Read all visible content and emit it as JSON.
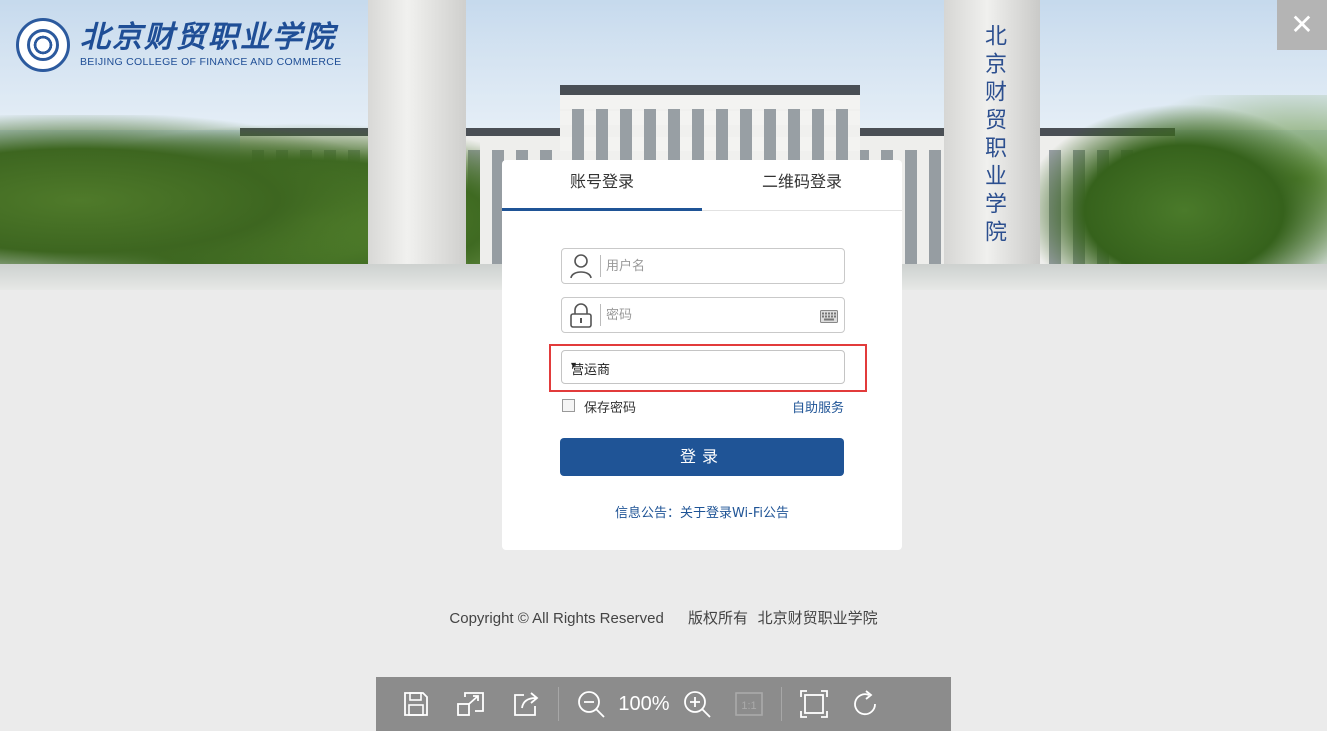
{
  "header": {
    "logo_cn": "北京财贸职业学院",
    "logo_en": "BEIJING COLLEGE OF FINANCE AND COMMERCE",
    "pillar_text": "北京财贸职业学院",
    "close_label": "✕"
  },
  "login": {
    "tabs": [
      {
        "label": "账号登录",
        "active": true
      },
      {
        "label": "二维码登录",
        "active": false
      }
    ],
    "username_placeholder": "用户名",
    "password_placeholder": "密码",
    "carrier_select": {
      "selected": "营运商",
      "arrow": "▾"
    },
    "remember_label": "保存密码",
    "self_service_label": "自助服务",
    "submit_label": "登录",
    "notice_text": "信息公告：关于登录Wi-Fi公告"
  },
  "footer": {
    "copyright_en": "Copyright © All Rights Reserved",
    "copyright_cn": "版权所有  北京财贸职业学院"
  },
  "viewer_toolbar": {
    "zoom_level": "100%",
    "actual_size_label": "1:1",
    "icons": [
      "save-icon",
      "resize-icon",
      "share-icon",
      "zoom-out-icon",
      "zoom-in-icon",
      "actual-size-icon",
      "fit-screen-icon",
      "rotate-icon"
    ]
  },
  "colors": {
    "accent": "#1f5496",
    "highlight_border": "#e23b3b",
    "background": "#ebebeb",
    "toolbar": "#8c8c8c"
  }
}
